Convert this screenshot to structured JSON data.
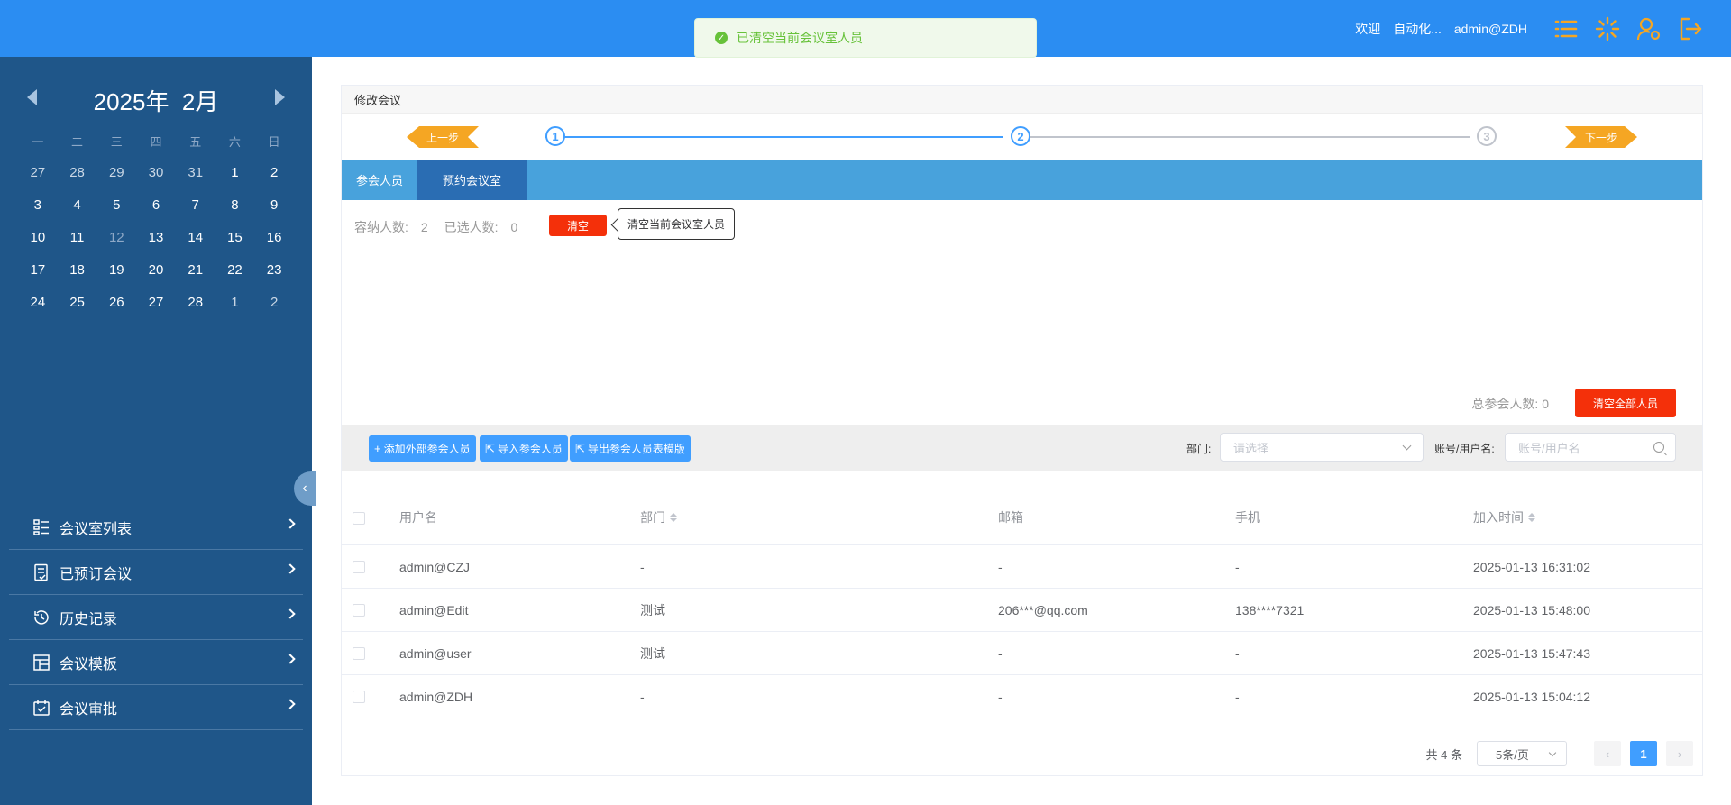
{
  "toast": {
    "message": "已清空当前会议室人员"
  },
  "header": {
    "welcome": "欢迎",
    "org": "自动化...",
    "user": "admin@ZDH"
  },
  "calendar": {
    "year_label": "2025年",
    "month_label": "2月",
    "weekdays": [
      "一",
      "二",
      "三",
      "四",
      "五",
      "六",
      "日"
    ],
    "days": [
      "27",
      "28",
      "29",
      "30",
      "31",
      "1",
      "2",
      "3",
      "4",
      "5",
      "6",
      "7",
      "8",
      "9",
      "10",
      "11",
      "12",
      "13",
      "14",
      "15",
      "16",
      "17",
      "18",
      "19",
      "20",
      "21",
      "22",
      "23",
      "24",
      "25",
      "26",
      "27",
      "28",
      "1",
      "2"
    ]
  },
  "menu": {
    "items": [
      {
        "label": "会议室列表",
        "icon": "list-icon"
      },
      {
        "label": "已预订会议",
        "icon": "booking-icon"
      },
      {
        "label": "历史记录",
        "icon": "history-icon"
      },
      {
        "label": "会议模板",
        "icon": "template-icon"
      },
      {
        "label": "会议审批",
        "icon": "approval-icon"
      }
    ]
  },
  "panel": {
    "title": "修改会议",
    "prev_step": "上一步",
    "next_step": "下一步",
    "steps": [
      "1",
      "2",
      "3"
    ]
  },
  "tabs": [
    "参会人员",
    "预约会议室"
  ],
  "room": {
    "capacity_label": "容纳人数:",
    "capacity": "2",
    "selected_label": "已选人数:",
    "selected": "0",
    "clear_label": "清空",
    "tooltip": "清空当前会议室人员",
    "total_label": "总参会人数:",
    "total": "0",
    "clear_all_label": "清空全部人员"
  },
  "toolbar": {
    "add_external": "添加外部参会人员",
    "import": "导入参会人员",
    "export_template": "导出参会人员表模版",
    "dept_label": "部门:",
    "dept_placeholder": "请选择",
    "account_label": "账号/用户名:",
    "account_placeholder": "账号/用户名"
  },
  "table": {
    "columns": [
      "用户名",
      "部门",
      "邮箱",
      "手机",
      "加入时间"
    ],
    "rows": [
      [
        "admin@CZJ",
        "-",
        "-",
        "-",
        "2025-01-13 16:31:02"
      ],
      [
        "admin@Edit",
        "测试",
        "206***@qq.com",
        "138****7321",
        "2025-01-13 15:48:00"
      ],
      [
        "admin@user",
        "测试",
        "-",
        "-",
        "2025-01-13 15:47:43"
      ],
      [
        "admin@ZDH",
        "-",
        "-",
        "-",
        "2025-01-13 15:04:12"
      ]
    ]
  },
  "pagination": {
    "total_text": "共 4 条",
    "page_size": "5条/页",
    "current_page": "1"
  },
  "colors": {
    "topbar": "#2b8df2",
    "sidebar": "#1f5689",
    "accent": "#409eff",
    "danger": "#f4300a",
    "step_button": "#f5a623"
  }
}
